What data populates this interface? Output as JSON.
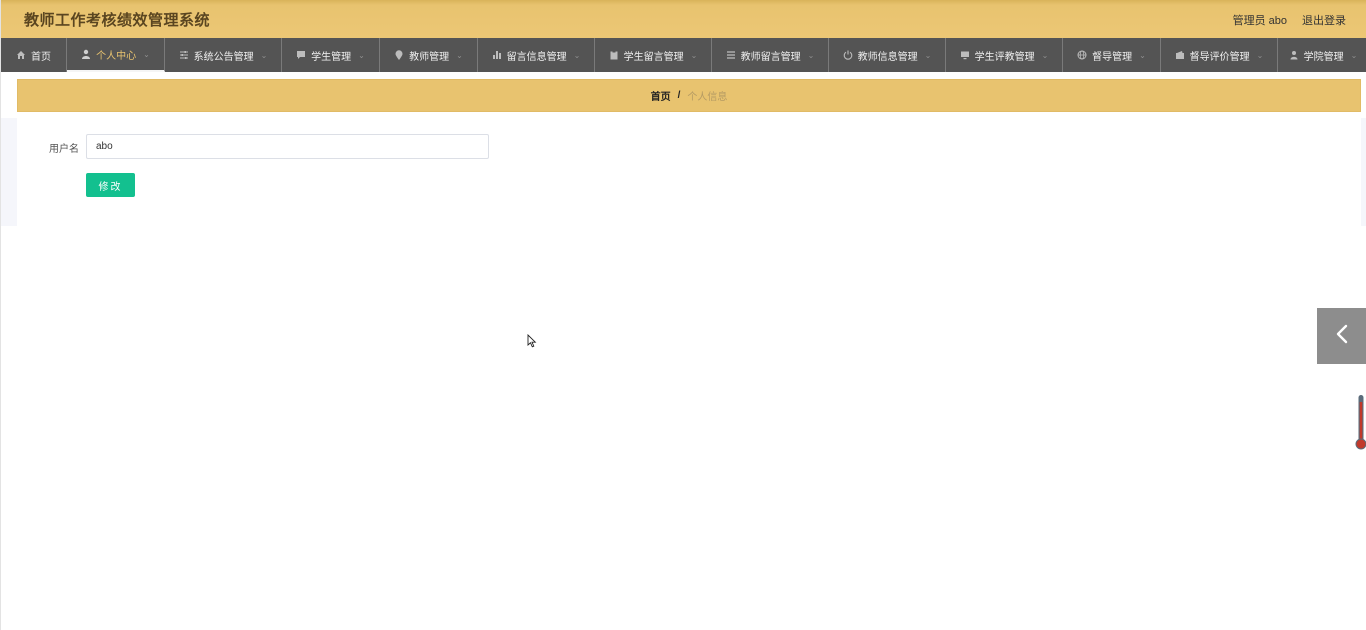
{
  "header": {
    "app_title": "教师工作考核绩效管理系统",
    "user_label": "管理员 abo",
    "logout_label": "退出登录"
  },
  "nav": {
    "items": [
      {
        "label": "首页",
        "icon": "home-icon"
      },
      {
        "label": "个人中心",
        "icon": "user-icon",
        "active": true
      },
      {
        "label": "系统公告管理",
        "icon": "sliders-icon"
      },
      {
        "label": "学生管理",
        "icon": "comment-icon"
      },
      {
        "label": "教师管理",
        "icon": "location-pin-icon"
      },
      {
        "label": "留言信息管理",
        "icon": "bar-chart-icon"
      },
      {
        "label": "学生留言管理",
        "icon": "clipboard-icon"
      },
      {
        "label": "教师留言管理",
        "icon": "list-icon"
      },
      {
        "label": "教师信息管理",
        "icon": "power-icon"
      },
      {
        "label": "学生评教管理",
        "icon": "monitor-icon"
      },
      {
        "label": "督导管理",
        "icon": "globe-icon"
      },
      {
        "label": "督导评价管理",
        "icon": "wallet-icon"
      },
      {
        "label": "学院管理",
        "icon": "person-icon"
      }
    ]
  },
  "breadcrumb": {
    "home": "首页",
    "separator": "/",
    "current": "个人信息"
  },
  "form": {
    "username_label": "用户名",
    "username_value": "abo",
    "submit_label": "修改"
  },
  "colors": {
    "header_bg": "#ecc775",
    "nav_bg": "#545454",
    "nav_active_text": "#e8c36f",
    "button_bg": "#13c08f"
  }
}
